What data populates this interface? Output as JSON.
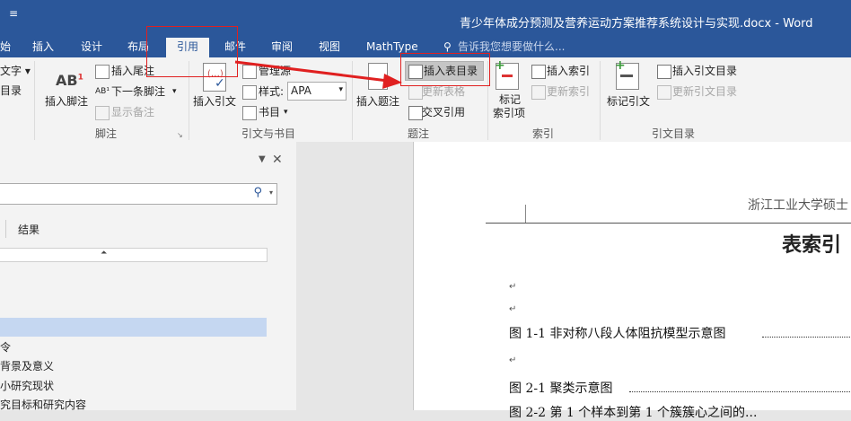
{
  "window": {
    "title": "青少年体成分预测及营养运动方案推荐系统设计与实现.docx - Word",
    "qat_icon": "quick-access-dropdown-icon"
  },
  "tabs": [
    {
      "label": "始"
    },
    {
      "label": "插入"
    },
    {
      "label": "设计"
    },
    {
      "label": "布局"
    },
    {
      "label": "引用",
      "active": true
    },
    {
      "label": "邮件"
    },
    {
      "label": "审阅"
    },
    {
      "label": "视图"
    },
    {
      "label": "MathType"
    }
  ],
  "tell_me": "告诉我您想要做什么...",
  "ribbon": {
    "toc": {
      "item1": "文字 ▾",
      "item2": "目录"
    },
    "footnotes": {
      "insert_footnote": "插入脚注",
      "insert_endnote": "插入尾注",
      "next_footnote": "下一条脚注",
      "show_notes": "显示备注",
      "group": "脚注"
    },
    "citations": {
      "insert_citation": "插入引文",
      "manage_sources": "管理源",
      "style_label": "样式:",
      "style_value": "APA",
      "bibliography": "书目",
      "group": "引文与书目"
    },
    "captions": {
      "insert_caption": "插入题注",
      "insert_table_of_figures": "插入表目录",
      "update_table": "更新表格",
      "cross_reference": "交叉引用",
      "group": "题注"
    },
    "index": {
      "mark_entry": "标记",
      "mark_entry2": "索引项",
      "insert_index": "插入索引",
      "update_index": "更新索引",
      "group": "索引"
    },
    "toa": {
      "mark_citation": "标记引文",
      "insert_toa": "插入引文目录",
      "update_toa": "更新引文目录",
      "group": "引文目录"
    }
  },
  "nav_pane": {
    "results_tab": "结果",
    "items": [
      "令",
      "背景及意义",
      "小研究现状",
      "究目标和研究内容"
    ]
  },
  "document": {
    "header": "浙江工业大学硕士",
    "heading": "表索引",
    "lines": [
      {
        "label": "图  1-1    非对称八段人体阻抗模型示意图"
      },
      {
        "label": "图  2-1  聚类示意图"
      },
      {
        "label": "图  2-2   第 1 个样本到第 1 个簇簇心之间的..."
      }
    ]
  },
  "colors": {
    "accent": "#2b579a",
    "highlight": "#e02020"
  }
}
